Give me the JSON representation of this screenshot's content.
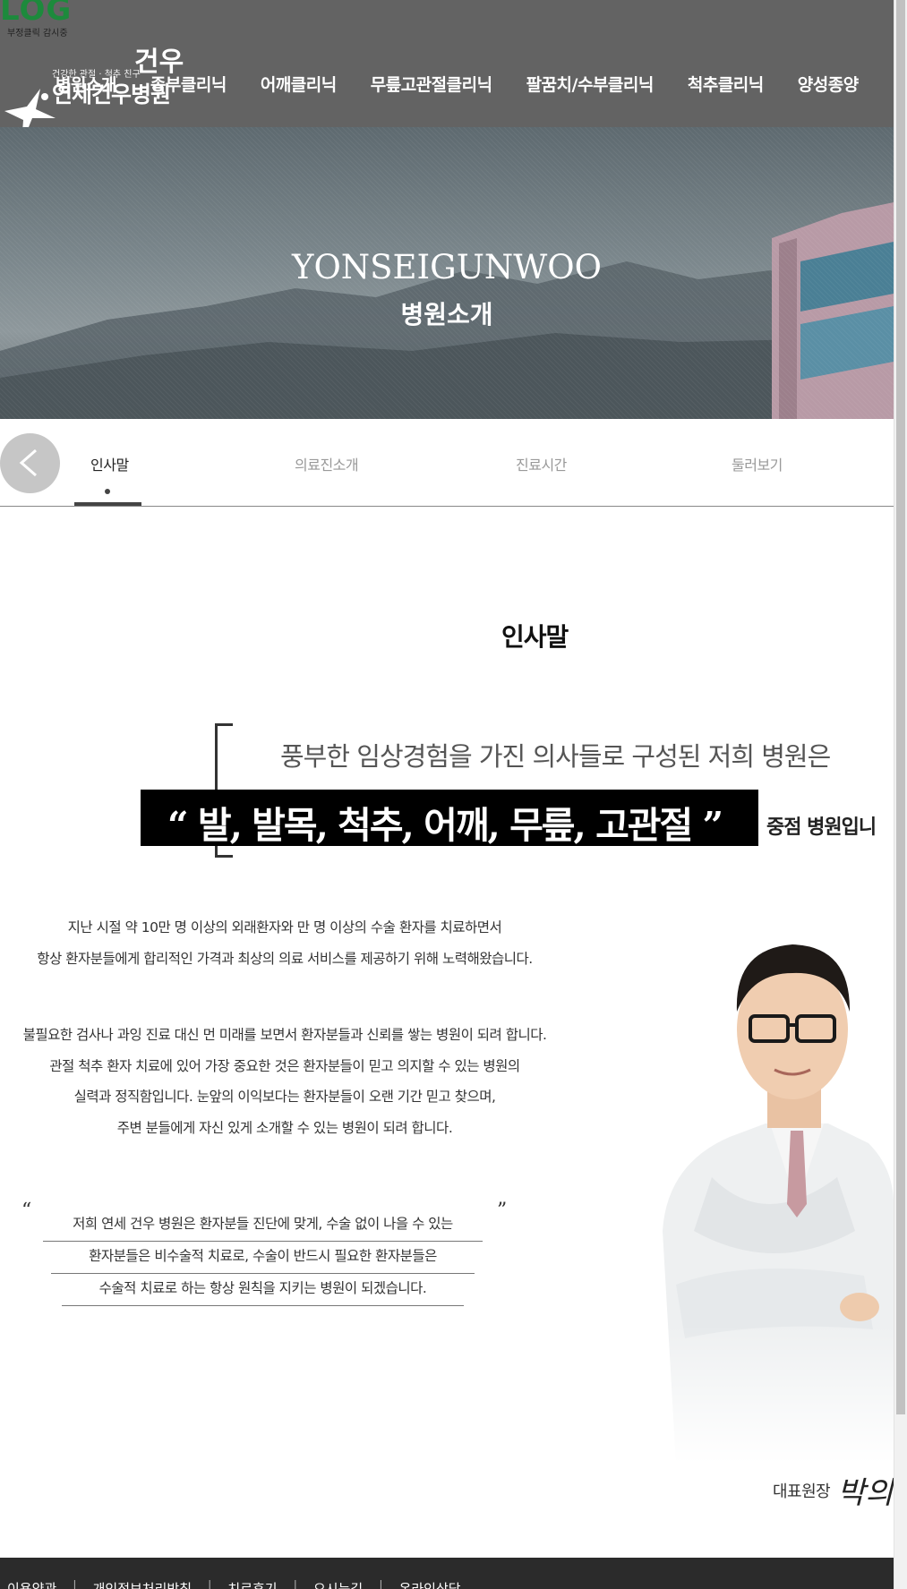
{
  "badge": {
    "text": "LOG",
    "sub": "부정클릭 감시중"
  },
  "logo": {
    "slogan": "건강한 관절 · 척추 친구",
    "big": "건우",
    "name": "연세건우병원"
  },
  "nav": {
    "items": [
      {
        "label": "병원소개"
      },
      {
        "label": "족부클리닉"
      },
      {
        "label": "어깨클리닉"
      },
      {
        "label": "무릎고관절클리닉"
      },
      {
        "label": "팔꿈치/수부클리닉"
      },
      {
        "label": "척추클리닉"
      },
      {
        "label": "양성종양"
      }
    ]
  },
  "hero": {
    "title": "YONSEIGUNWOO",
    "subtitle": "병원소개"
  },
  "tabs": {
    "items": [
      {
        "label": "인사말"
      },
      {
        "label": "의료진소개"
      },
      {
        "label": "진료시간"
      },
      {
        "label": "둘러보기"
      }
    ],
    "active": "인사말"
  },
  "greeting": {
    "title": "인사말",
    "quote_line1": "풍부한 임상경험을 가진 의사들로 구성된 저희 병원은",
    "quote_highlight": "“ 발, 발목, 척추, 어깨, 무릎, 고관절 ”",
    "quote_tail": "중점 병원입니",
    "para1": [
      "지난 시절 약 10만 명 이상의 외래환자와 만 명 이상의 수술 환자를 치료하면서",
      "항상 환자분들에게 합리적인 가격과 최상의 의료 서비스를 제공하기 위해 노력해왔습니다."
    ],
    "para2": [
      "불필요한 검사나 과잉 진료 대신 먼 미래를 보면서 환자분들과 신뢰를 쌓는 병원이 되려 합니다.",
      "관절 척추 환자 치료에 있어 가장 중요한 것은 환자분들이 믿고 의지할 수 있는 병원의",
      "실력과 정직함입니다. 눈앞의 이익보다는 환자분들이 오랜 기간 믿고 찾으며,",
      "주변 분들에게 자신 있게 소개할 수 있는 병원이 되려 합니다."
    ],
    "open_quote": "“",
    "close_quote": "”",
    "closing_lines": [
      "저희 연세 건우 병원은 환자분들 진단에 맞게, 수술 없이 나을 수 있는",
      "환자분들은 비수술적 치료로, 수술이 반드시 필요한 환자분들은",
      "수술적 치료로 하는 항상 원칙을 지키는 병원이 되겠습니다."
    ],
    "signature_role": "대표원장",
    "signature_name": "박의"
  },
  "footer": {
    "links": [
      {
        "label": "이용약관"
      },
      {
        "label": "개인정보처리방침"
      },
      {
        "label": "치료후기"
      },
      {
        "label": "오시는길"
      },
      {
        "label": "온라인상담"
      }
    ]
  },
  "colors": {
    "header_bg": "#636363",
    "badge_green": "#1d8a3c",
    "footer_bg": "#2b2b2b",
    "quote_box": "#000000"
  }
}
